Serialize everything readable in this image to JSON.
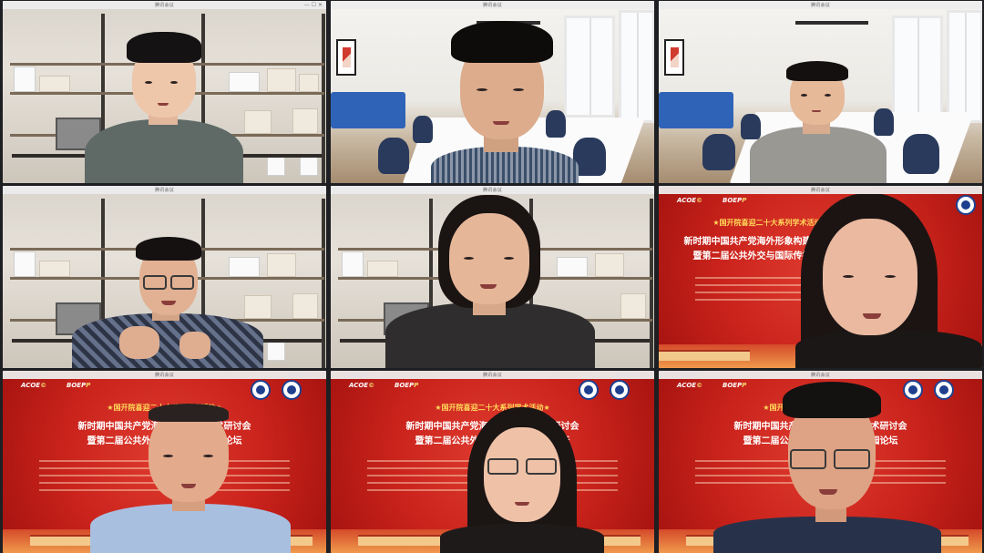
{
  "window_title": "腾讯会议",
  "window_controls": "— ☐ ✕",
  "tiles": [
    {
      "id": "t1",
      "background": "bookshelf",
      "person": "man-grey-shirt"
    },
    {
      "id": "t2",
      "background": "office",
      "person": "young-man-striped-shirt"
    },
    {
      "id": "t3",
      "background": "office",
      "person": "man-grey-hoodie"
    },
    {
      "id": "t4",
      "background": "bookshelf",
      "person": "man-glasses-plaid-shirt"
    },
    {
      "id": "t5",
      "background": "bookshelf",
      "person": "young-woman-dark-shirt"
    },
    {
      "id": "t6",
      "background": "banner",
      "person": "woman-long-hair"
    },
    {
      "id": "t7",
      "background": "banner",
      "person": "man-light-blue-shirt"
    },
    {
      "id": "t8",
      "background": "banner",
      "person": "woman-glasses"
    },
    {
      "id": "t9",
      "background": "banner",
      "person": "man-glasses-suit"
    }
  ],
  "banner": {
    "logo_left": "ACOE",
    "logo_left_accent": "©",
    "logo_right": "BOEP",
    "logo_right_accent": "P",
    "line1": "★国开院喜迎二十大系列学术活动★",
    "line2": "新时期中国共产党海外形象构建学术研讨会",
    "line3": "暨第二届公共外交与国际传播校园论坛"
  },
  "colors": {
    "banner_red": "#c8221b",
    "banner_gold": "#ffd95a",
    "sofa_blue": "#2f63b7",
    "emblem_blue": "#1e3f8f"
  }
}
